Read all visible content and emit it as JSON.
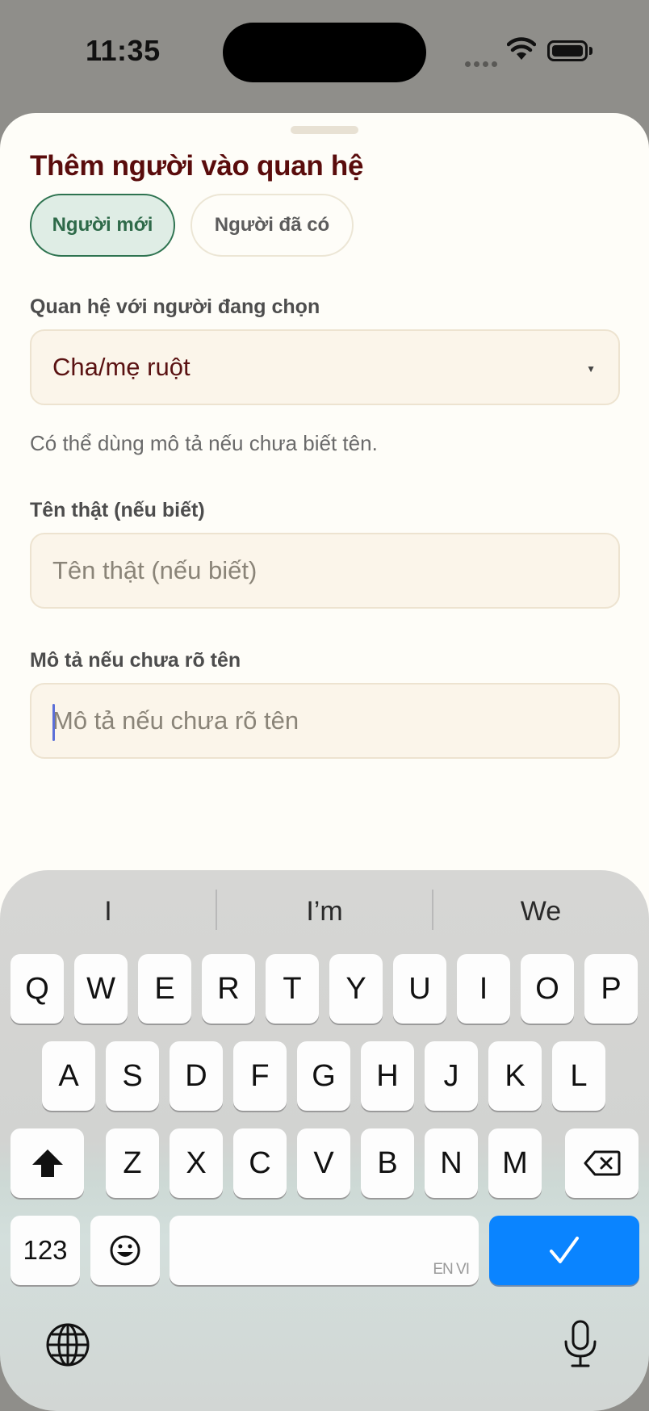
{
  "status_bar": {
    "time": "11:35"
  },
  "sheet": {
    "title": "Thêm người vào quan hệ",
    "segments": [
      {
        "label": "Người mới",
        "selected": true
      },
      {
        "label": "Người đã có",
        "selected": false
      }
    ],
    "relation": {
      "label": "Quan hệ với người đang chọn",
      "value": "Cha/mẹ ruột"
    },
    "hint": "Có thể dùng mô tả nếu chưa biết tên.",
    "real_name": {
      "label": "Tên thật (nếu biết)",
      "placeholder": "Tên thật (nếu biết)"
    },
    "description": {
      "label": "Mô tả nếu chưa rõ tên",
      "placeholder": "Mô tả nếu chưa rõ tên"
    },
    "accent_color": "#2e7350",
    "title_color": "#5a0c0c"
  },
  "keyboard": {
    "suggestions": [
      "I",
      "I’m",
      "We"
    ],
    "row1": [
      "Q",
      "W",
      "E",
      "R",
      "T",
      "Y",
      "U",
      "I",
      "O",
      "P"
    ],
    "row2": [
      "A",
      "S",
      "D",
      "F",
      "G",
      "H",
      "J",
      "K",
      "L"
    ],
    "row3": [
      "Z",
      "X",
      "C",
      "V",
      "B",
      "N",
      "M"
    ],
    "numbers_label": "123",
    "space_languages": "EN VI",
    "return_color": "#0a84ff",
    "icons": [
      "shift-icon",
      "backspace-icon",
      "emoji-icon",
      "checkmark-icon",
      "globe-icon",
      "microphone-icon"
    ]
  }
}
